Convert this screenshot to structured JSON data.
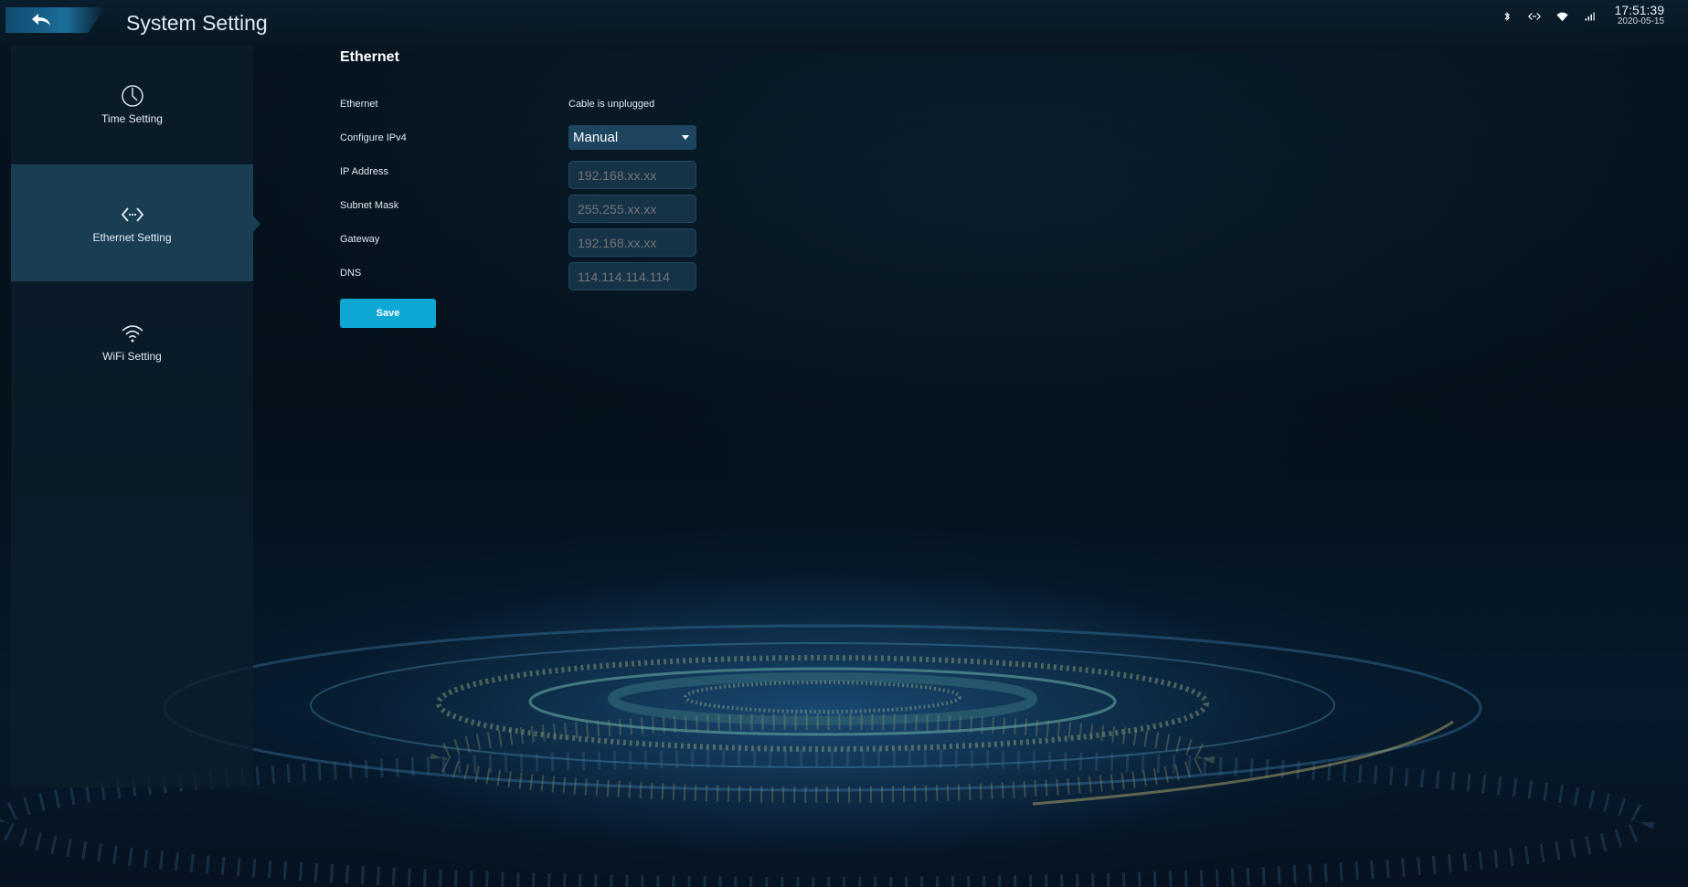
{
  "header": {
    "title": "System Setting",
    "time": "17:51:39",
    "date": "2020-05-15",
    "status_icons": [
      "bluetooth-icon",
      "ethernet-icon",
      "wifi-icon",
      "signal-icon"
    ]
  },
  "sidebar": {
    "items": [
      {
        "label": "Time Setting",
        "icon": "clock-icon",
        "active": false
      },
      {
        "label": "Ethernet Setting",
        "icon": "ethernet-icon",
        "active": true
      },
      {
        "label": "WiFi Setting",
        "icon": "wifi-icon",
        "active": false
      }
    ]
  },
  "main": {
    "section_title": "Ethernet",
    "labels": {
      "ethernet": "Ethernet",
      "configure_ipv4": "Configure IPv4",
      "ip_address": "IP Address",
      "subnet_mask": "Subnet Mask",
      "gateway": "Gateway",
      "dns": "DNS"
    },
    "ethernet_status": "Cable is unplugged",
    "configure_ipv4_value": "Manual",
    "ip_address_placeholder": "192.168.xx.xx",
    "subnet_mask_placeholder": "255.255.xx.xx",
    "gateway_placeholder": "192.168.xx.xx",
    "dns_placeholder": "114.114.114.114",
    "save_label": "Save"
  },
  "colors": {
    "accent": "#0fa8d4",
    "sidebar_active": "#1a4056",
    "field_bg": "#153247"
  }
}
